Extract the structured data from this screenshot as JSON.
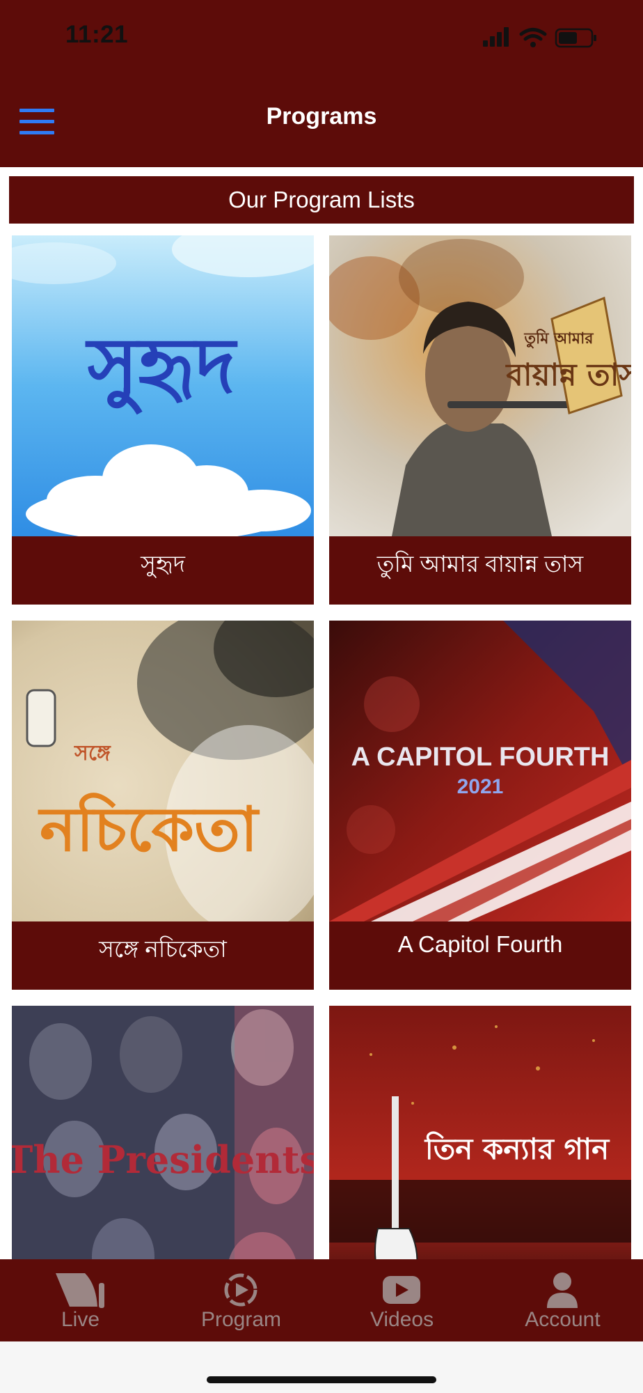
{
  "status_bar": {
    "time": "11:21"
  },
  "nav": {
    "title": "Programs"
  },
  "section": {
    "header": "Our Program Lists"
  },
  "programs": [
    {
      "label": "সুহৃদ",
      "art_text": "সুহৃদ"
    },
    {
      "label": "তুমি আমার বায়ান্ন তাস",
      "art_text_small": "তুমি আমার",
      "art_text": "বায়ান্ন তাস"
    },
    {
      "label": "সঙ্গে নচিকেতা",
      "art_text_small": "সঙ্গে",
      "art_text": "নচিকেতা"
    },
    {
      "label": "A Capitol Fourth",
      "art_text": "A CAPITOL FOURTH",
      "art_sub": "2021"
    },
    {
      "label": "",
      "art_text": "The Presidents"
    },
    {
      "label": "",
      "art_text": "তিন কন্যার গান"
    }
  ],
  "tabs": [
    {
      "label": "Live",
      "icon": "live-icon"
    },
    {
      "label": "Program",
      "icon": "program-icon"
    },
    {
      "label": "Videos",
      "icon": "videos-icon"
    },
    {
      "label": "Account",
      "icon": "account-icon"
    }
  ],
  "colors": {
    "brand": "#5d0c09",
    "menu_accent": "#2f7bf5",
    "tab_inactive": "#9a8685"
  }
}
